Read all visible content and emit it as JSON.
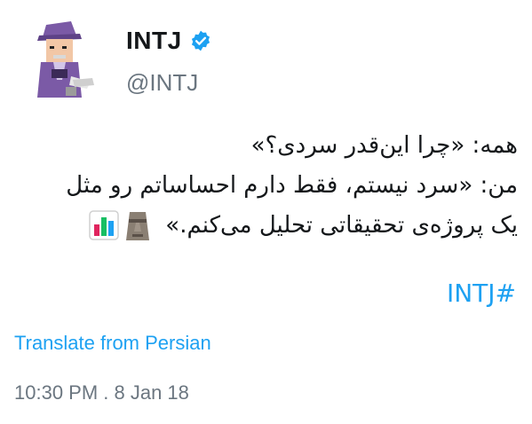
{
  "account": {
    "name": "INTJ",
    "handle": "@INTJ",
    "verified": true,
    "verified_color": "#1da1f2"
  },
  "tweet": {
    "lines": [
      "همه: «چرا این‌قدر سردی؟»",
      "من: «سرد نیستم، فقط دارم احساساتم رو مثل",
      "یک پروژه‌ی تحقیقاتی تحلیل می‌کنم.»"
    ],
    "emojis": [
      "moai-icon",
      "bar-chart-icon"
    ],
    "hashtag": "INTJ#"
  },
  "actions": {
    "translate_label": "Translate from Persian"
  },
  "meta": {
    "timestamp": "10:30 PM . 8 Jan 18"
  },
  "colors": {
    "link": "#1da1f2",
    "text": "#14171a",
    "secondary": "#6b7680"
  }
}
